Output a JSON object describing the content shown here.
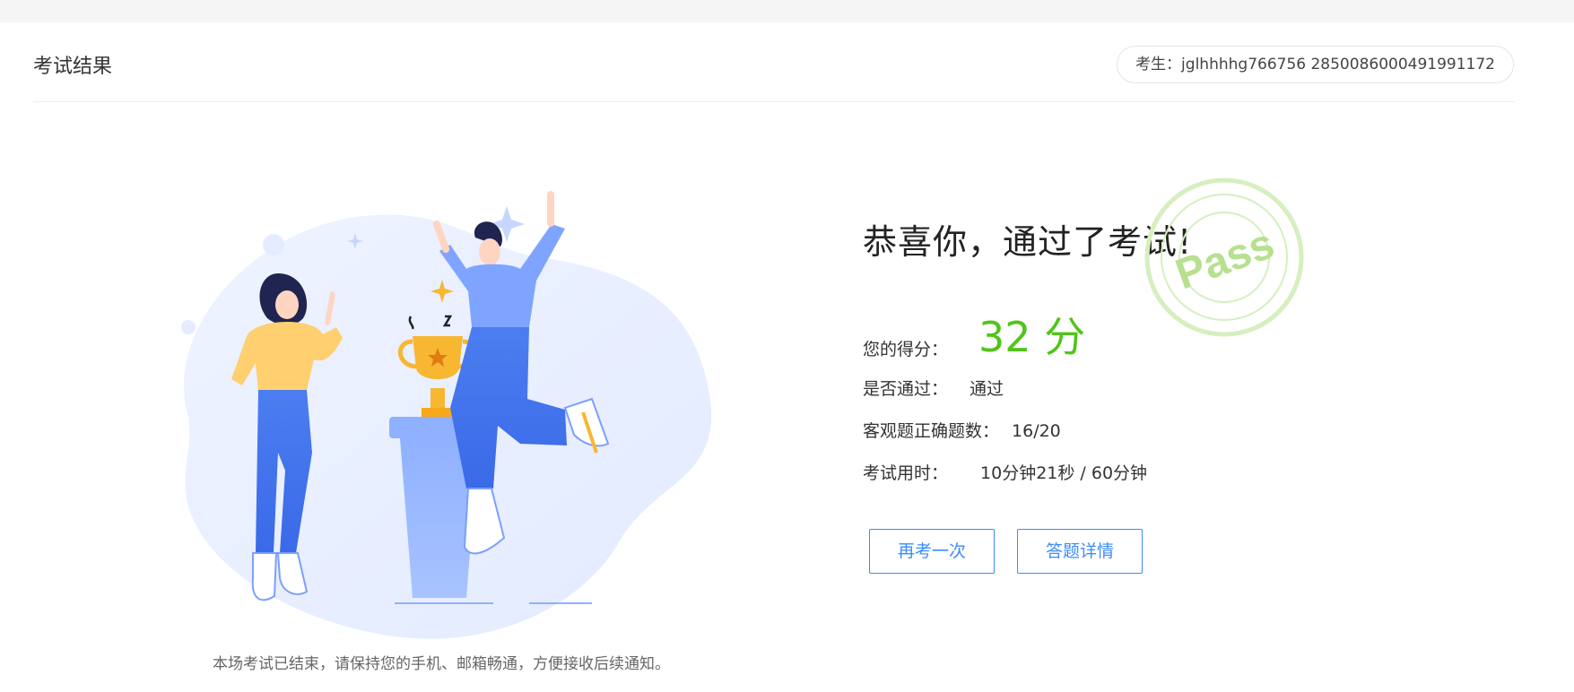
{
  "header": {
    "title": "考试结果",
    "candidate": "考生：jglhhhhg766756 2850086000491991172"
  },
  "result": {
    "congrats": "恭喜你，通过了考试!",
    "stamp_text": "Pass",
    "score_label": "您的得分：",
    "score_value": "32 分",
    "pass_label": "是否通过：",
    "pass_value": "通过",
    "objective_label": "客观题正确题数：",
    "objective_value": "16/20",
    "time_label": "考试用时：",
    "time_value": "10分钟21秒 / 60分钟"
  },
  "actions": {
    "retry_label": "再考一次",
    "detail_label": "答题详情"
  },
  "footer": {
    "note": "本场考试已结束，请保持您的手机、邮箱畅通，方便接收后续通知。"
  },
  "colors": {
    "accent": "#3b8cff",
    "score": "#52c41a",
    "stamp": "#b7e08f"
  },
  "icons": {
    "illustration": "celebration-trophy-illustration",
    "stamp": "pass-stamp-icon"
  }
}
